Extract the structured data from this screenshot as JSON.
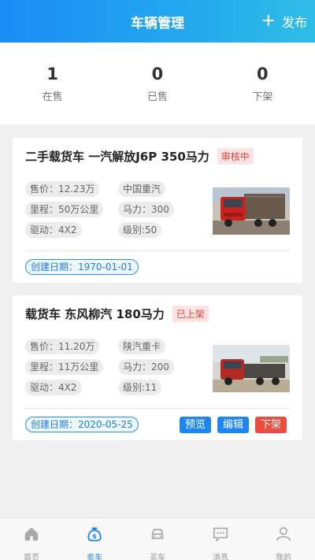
{
  "header": {
    "title": "车辆管理",
    "publish_label": "发布"
  },
  "stats": [
    {
      "num": "1",
      "label": "在售"
    },
    {
      "num": "0",
      "label": "已售"
    },
    {
      "num": "0",
      "label": "下架"
    }
  ],
  "cards": [
    {
      "title": "二手载货车 一汽解放J6P 350马力",
      "badge": "审核中",
      "chips": [
        "售价：12.23万",
        "中国重汽",
        "里程：50万公里",
        "马力：300",
        "驱动：4X2",
        "级别:50"
      ],
      "date": "创建日期：1970-01-01"
    },
    {
      "title": "载货车 东风柳汽 180马力",
      "badge": "已上架",
      "chips": [
        "售价：11.20万",
        "陕汽重卡",
        "里程：11万公里",
        "马力：200",
        "驱动：4X2",
        "级别:11"
      ],
      "date": "创建日期：2020-05-25",
      "actions": [
        "预览",
        "编辑",
        "下架"
      ]
    }
  ],
  "tabbar": [
    {
      "label": "首页",
      "icon": "home-icon",
      "active": false
    },
    {
      "label": "卖车",
      "icon": "sell-car-icon",
      "active": true
    },
    {
      "label": "买车",
      "icon": "buy-car-icon",
      "active": false
    },
    {
      "label": "消息",
      "icon": "message-icon",
      "active": false
    },
    {
      "label": "我的",
      "icon": "profile-icon",
      "active": false
    }
  ],
  "colors": {
    "accent": "#1e86ee",
    "danger": "#e84d40",
    "badge_bg": "#fde3e3"
  }
}
